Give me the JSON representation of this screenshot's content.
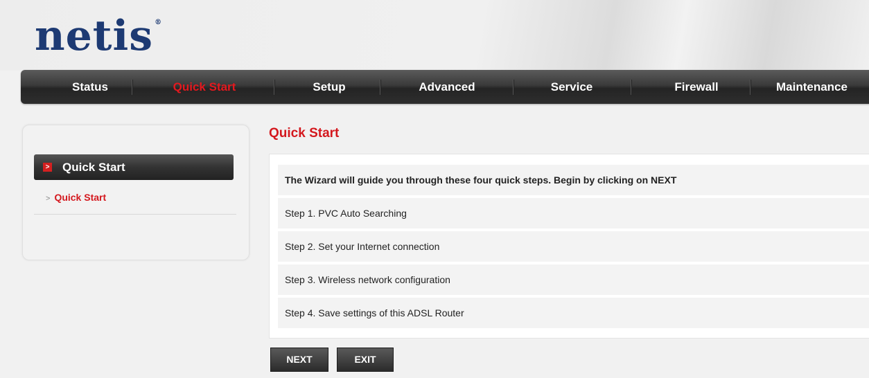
{
  "brand": {
    "logo_text": "netis",
    "registered_mark": "®",
    "logo_color": "#1d3a73"
  },
  "nav": {
    "items": [
      {
        "label": "Status",
        "active": false
      },
      {
        "label": "Quick Start",
        "active": true
      },
      {
        "label": "Setup",
        "active": false
      },
      {
        "label": "Advanced",
        "active": false
      },
      {
        "label": "Service",
        "active": false
      },
      {
        "label": "Firewall",
        "active": false
      },
      {
        "label": "Maintenance",
        "active": false
      }
    ],
    "active_color": "#e4181e"
  },
  "sidebar": {
    "header_label": "Quick Start",
    "header_icon": "arrow-right-icon",
    "sub_items": [
      {
        "label": "Quick Start",
        "icon": "chevron-right-icon"
      }
    ]
  },
  "main": {
    "title": "Quick Start",
    "intro": "The Wizard will guide you through these four quick steps. Begin by clicking on NEXT",
    "steps": [
      "Step 1. PVC Auto Searching",
      "Step 2. Set your Internet connection",
      "Step 3. Wireless network configuration",
      "Step 4. Save settings of this ADSL Router"
    ]
  },
  "buttons": {
    "next": "NEXT",
    "exit": "EXIT"
  },
  "colors": {
    "accent_red": "#d4181e",
    "nav_dark": "#2e2e2e"
  }
}
